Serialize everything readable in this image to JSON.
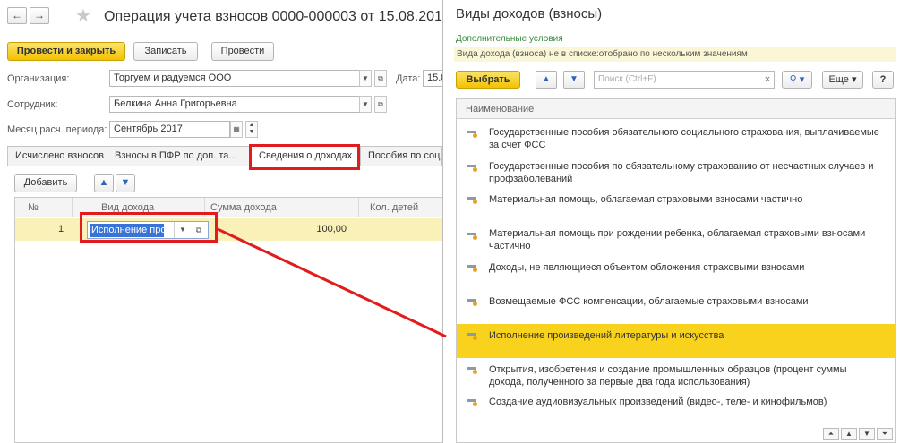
{
  "doc": {
    "title": "Операция учета взносов 0000-000003 от 15.08.201",
    "nav_back": "←",
    "nav_forward": "→",
    "toolbar": {
      "post_close": "Провести и закрыть",
      "save": "Записать",
      "post": "Провести"
    },
    "fields": {
      "org_label": "Организация:",
      "org_value": "Торгуем и радуемся ООО",
      "date_label": "Дата:",
      "date_value": "15.0",
      "employee_label": "Сотрудник:",
      "employee_value": "Белкина Анна Григорьевна",
      "month_label": "Месяц расч. периода:",
      "month_value": "Сентябрь 2017"
    },
    "tabs": [
      {
        "label": "Исчислено взносов"
      },
      {
        "label": "Взносы в ПФР по доп. та..."
      },
      {
        "label": "Сведения о доходах"
      },
      {
        "label": "Пособия по соц"
      }
    ],
    "grid": {
      "add_label": "Добавить",
      "columns": [
        "№",
        "Вид дохода",
        "Сумма дохода",
        "Кол. детей"
      ],
      "row": {
        "num": "1",
        "kind": "Исполнение про",
        "sum": "100,00"
      }
    }
  },
  "selection": {
    "title": "Виды доходов (взносы)",
    "additional_conditions": "Дополнительные условия",
    "filter_text": "Вида дохода (взноса) не в списке:отобрано по нескольким значениям",
    "select_label": "Выбрать",
    "search_placeholder": "Поиск (Ctrl+F)",
    "more_label": "Еще",
    "help_label": "?",
    "column_header": "Наименование",
    "items": [
      "Государственные пособия обязательного социального страхования, выплачиваемые за счет ФСС",
      "Государственные пособия по обязательному страхованию от несчастных случаев и профзаболеваний",
      "Материальная помощь, облагаемая страховыми взносами частично",
      "Материальная помощь при рождении ребенка, облагаемая страховыми взносами частично",
      "Доходы, не являющиеся объектом обложения страховыми взносами",
      "Возмещаемые ФСС компенсации, облагаемые страховыми взносами",
      "Исполнение произведений литературы и искусства",
      "Открытия, изобретения и создание промышленных образцов (процент суммы дохода, полученного за первые два года использования)",
      "Создание аудиовизуальных произведений (видео-, теле- и кинофильмов)"
    ]
  },
  "colors": {
    "accent_yellow": "#f2c200",
    "selected_row": "#f9d21d",
    "highlight_red": "#e21c1c",
    "edit_selection_blue": "#3874d8"
  }
}
